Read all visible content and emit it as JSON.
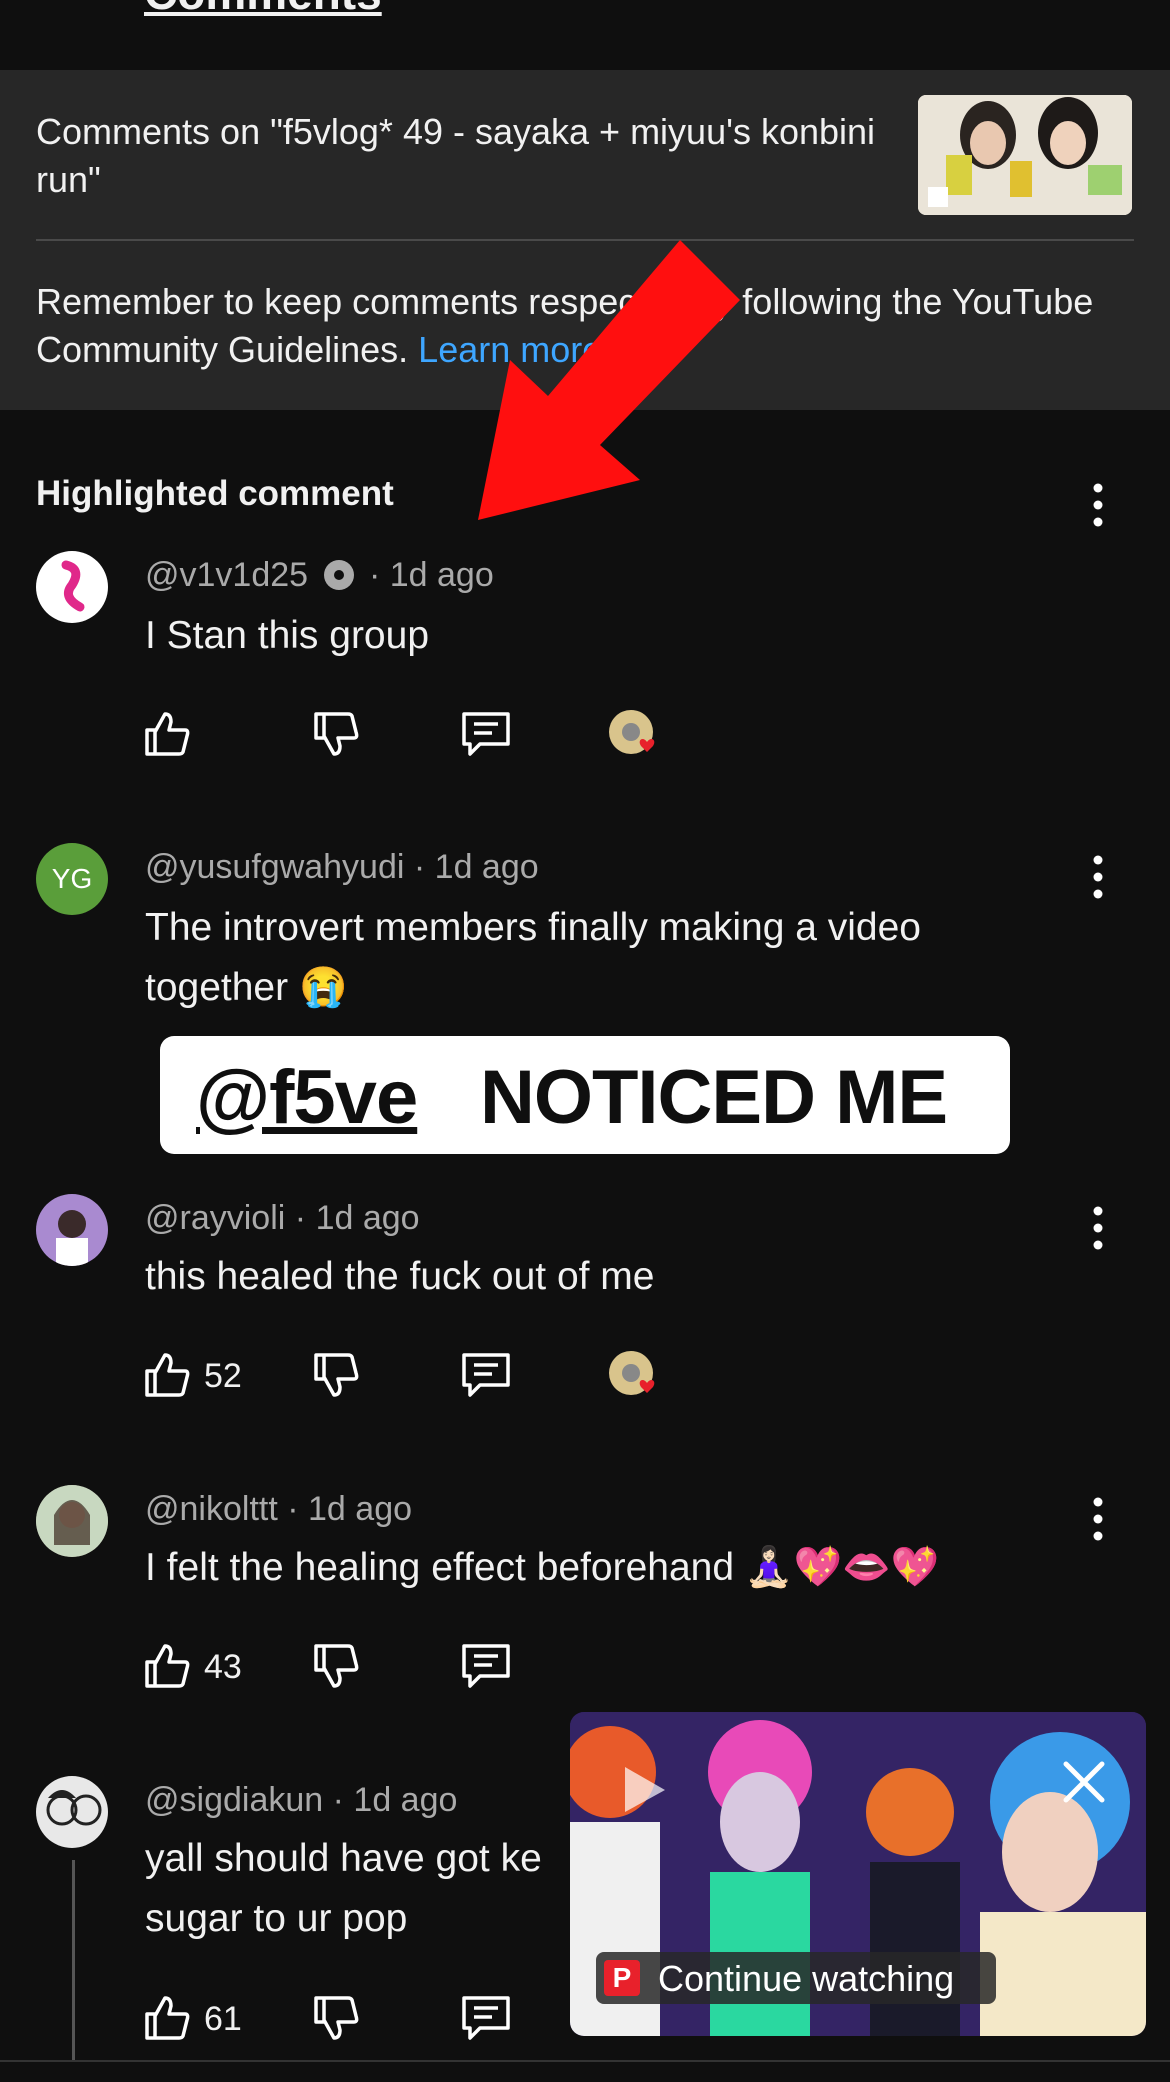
{
  "header": {
    "title": "Comments",
    "video_title": "Comments on \"f5vlog* 49 - sayaka + miyuu's konbini run\"",
    "guidelines_text": "Remember to keep comments respectful by following the YouTube Community Guidelines.",
    "learn_more": "Learn more"
  },
  "section": {
    "highlighted_label": "Highlighted comment"
  },
  "overlay": {
    "handle": "@f5ve",
    "text": "NOTICED ME"
  },
  "comments": [
    {
      "author": "@v1v1d25",
      "time": "1d ago",
      "text": "I Stan this group",
      "likes": "",
      "creator_heart": true,
      "avatar_color": "#ffffff"
    },
    {
      "author": "@yusufgwahyudi",
      "time": "1d ago",
      "text": "The introvert members finally making a video together 😭",
      "likes": "",
      "creator_heart": false,
      "avatar_initials": "YG",
      "avatar_color": "#5a9e3a"
    },
    {
      "author": "@rayvioli",
      "time": "1d ago",
      "text": "this healed the fuck out of me",
      "likes": "52",
      "creator_heart": true,
      "avatar_color": "#a98ad0"
    },
    {
      "author": "@nikolttt",
      "time": "1d ago",
      "text": "I felt the healing effect beforehand 🧘🏻‍♀️💖👄💖",
      "likes": "43",
      "creator_heart": false,
      "avatar_color": "#7a6a60"
    },
    {
      "author": "@sigdiakun",
      "time": "1d ago",
      "text_line1": "yall should have got ke",
      "text_line2": "sugar to ur pop",
      "likes": "61",
      "creator_heart": false,
      "avatar_color": "#e8e8e8"
    }
  ],
  "mini_player": {
    "continue_label": "Continue watching",
    "logo_letter": "P"
  },
  "colors": {
    "background": "#0f0f0f",
    "panel": "#272727",
    "link": "#3ea6ff",
    "heart": "#e8212b"
  }
}
